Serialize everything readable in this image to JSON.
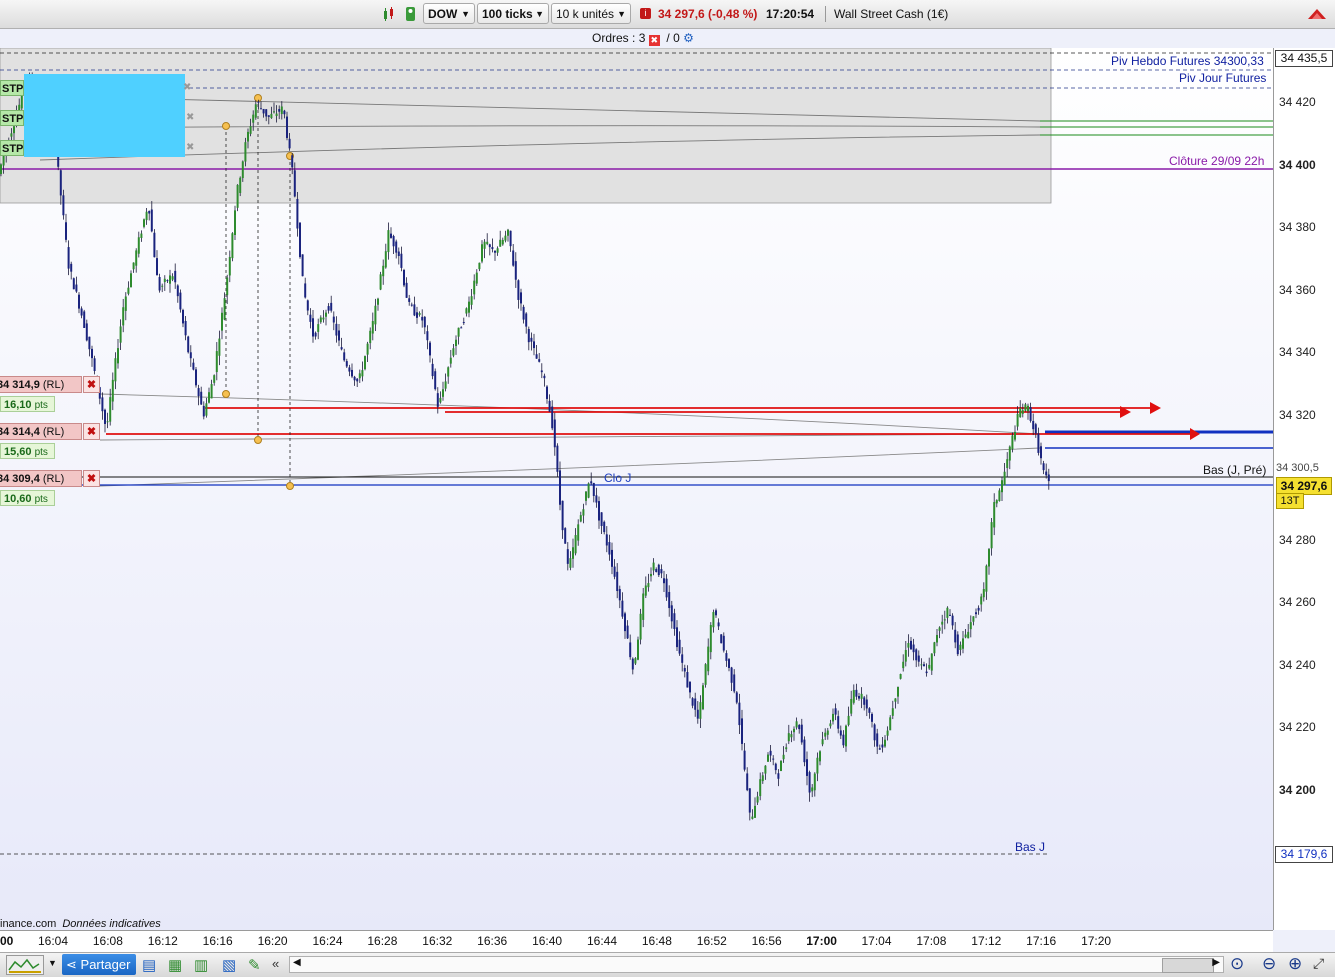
{
  "toolbar": {
    "symbol": "DOW",
    "timeframe": "100 ticks",
    "units": "10 k unités",
    "price_change": "34 297,6 (-0,48 %)",
    "time": "17:20:54",
    "instrument": "Wall Street Cash (1€)",
    "down_color": "#c21818"
  },
  "orders": {
    "label": "Ordres :",
    "count": "3",
    "separator": "/",
    "pending": "0"
  },
  "chart": {
    "piv_hebdo": "Piv Hebdo Futures 34300,33",
    "piv_jour": "Piv Jour Futures",
    "cloture": "Clôture 29/09 22h",
    "clo_j": "Clo J",
    "bas_j": "Bas J",
    "bas_j_pre": "Bas (J, Pré)",
    "source": "inance.com",
    "source_note": "Données indicatives",
    "stp_label": "STP",
    "orders": [
      {
        "price": "34 314,9",
        "type": "(RL)",
        "pts": "16,10",
        "unit": "pts"
      },
      {
        "price": "34 314,4",
        "type": "(RL)",
        "pts": "15,60",
        "unit": "pts"
      },
      {
        "price": "34 309,4",
        "type": "(RL)",
        "pts": "10,60",
        "unit": "pts"
      }
    ],
    "current_price": "34 297,6",
    "tick_count": "13T",
    "top_price_box": "34 435,5",
    "bottom_price_box": "34 179,6",
    "hidden_price_1": "34 300,5",
    "colors": {
      "bull": "#2e8b2e",
      "bear": "#1a237e",
      "order_line": "#e01010",
      "target_line": "#1030c0",
      "close_line": "#8a1aa8",
      "highlight": "#4fd0ff"
    }
  },
  "chart_data": {
    "type": "candlestick",
    "instrument": "Wall Street Cash (1€)",
    "ylim": [
      34170,
      34445
    ],
    "y_ticks": [
      "34 420",
      "34 400",
      "34 380",
      "34 360",
      "34 340",
      "34 320",
      "34 280",
      "34 260",
      "34 240",
      "34 220",
      "34 200"
    ],
    "x_ticks": [
      "00",
      "16:04",
      "16:08",
      "16:12",
      "16:16",
      "16:20",
      "16:24",
      "16:28",
      "16:32",
      "16:36",
      "16:40",
      "16:44",
      "16:48",
      "16:52",
      "16:56",
      "17:00",
      "17:04",
      "17:08",
      "17:12",
      "17:16",
      "17:20"
    ],
    "path": [
      [
        0,
        34397
      ],
      [
        10,
        34408
      ],
      [
        20,
        34418
      ],
      [
        30,
        34430
      ],
      [
        40,
        34404
      ],
      [
        55,
        34412
      ],
      [
        70,
        34368
      ],
      [
        85,
        34350
      ],
      [
        100,
        34328
      ],
      [
        108,
        34315
      ],
      [
        115,
        34332
      ],
      [
        125,
        34355
      ],
      [
        140,
        34375
      ],
      [
        150,
        34388
      ],
      [
        160,
        34360
      ],
      [
        175,
        34365
      ],
      [
        190,
        34340
      ],
      [
        205,
        34320
      ],
      [
        215,
        34332
      ],
      [
        228,
        34362
      ],
      [
        238,
        34390
      ],
      [
        248,
        34408
      ],
      [
        258,
        34420
      ],
      [
        270,
        34415
      ],
      [
        285,
        34418
      ],
      [
        295,
        34395
      ],
      [
        305,
        34360
      ],
      [
        315,
        34345
      ],
      [
        330,
        34355
      ],
      [
        345,
        34338
      ],
      [
        360,
        34330
      ],
      [
        375,
        34350
      ],
      [
        390,
        34378
      ],
      [
        400,
        34372
      ],
      [
        410,
        34355
      ],
      [
        425,
        34350
      ],
      [
        440,
        34322
      ],
      [
        455,
        34342
      ],
      [
        470,
        34355
      ],
      [
        485,
        34375
      ],
      [
        495,
        34372
      ],
      [
        510,
        34378
      ],
      [
        520,
        34358
      ],
      [
        530,
        34345
      ],
      [
        545,
        34332
      ],
      [
        555,
        34315
      ],
      [
        562,
        34290
      ],
      [
        570,
        34270
      ],
      [
        580,
        34285
      ],
      [
        592,
        34300
      ],
      [
        600,
        34288
      ],
      [
        612,
        34275
      ],
      [
        625,
        34255
      ],
      [
        635,
        34238
      ],
      [
        645,
        34262
      ],
      [
        655,
        34272
      ],
      [
        665,
        34268
      ],
      [
        680,
        34245
      ],
      [
        692,
        34230
      ],
      [
        700,
        34222
      ],
      [
        715,
        34258
      ],
      [
        725,
        34245
      ],
      [
        738,
        34230
      ],
      [
        745,
        34210
      ],
      [
        752,
        34190
      ],
      [
        760,
        34200
      ],
      [
        770,
        34212
      ],
      [
        780,
        34205
      ],
      [
        790,
        34218
      ],
      [
        800,
        34222
      ],
      [
        812,
        34198
      ],
      [
        820,
        34212
      ],
      [
        835,
        34225
      ],
      [
        845,
        34215
      ],
      [
        855,
        34232
      ],
      [
        868,
        34228
      ],
      [
        880,
        34212
      ],
      [
        888,
        34218
      ],
      [
        898,
        34232
      ],
      [
        910,
        34248
      ],
      [
        920,
        34240
      ],
      [
        930,
        34238
      ],
      [
        940,
        34252
      ],
      [
        950,
        34258
      ],
      [
        960,
        34244
      ],
      [
        970,
        34252
      ],
      [
        985,
        34262
      ],
      [
        995,
        34290
      ],
      [
        1005,
        34300
      ],
      [
        1015,
        34314
      ],
      [
        1022,
        34322
      ],
      [
        1030,
        34322
      ],
      [
        1038,
        34312
      ],
      [
        1045,
        34302
      ],
      [
        1050,
        34297.6
      ]
    ]
  }
}
